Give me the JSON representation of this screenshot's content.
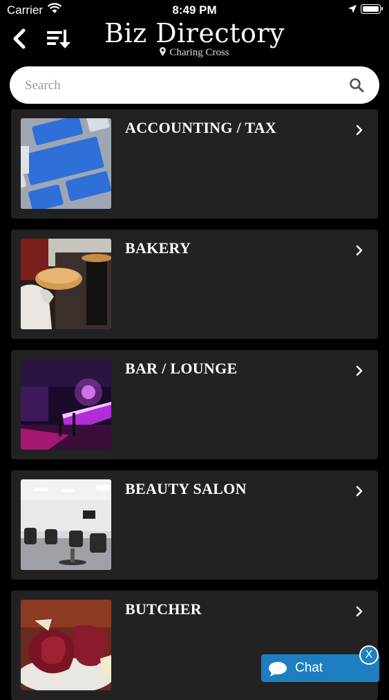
{
  "status_bar": {
    "carrier": "Carrier",
    "time": "8:49 PM"
  },
  "header": {
    "title": "Biz Directory",
    "location": "Charing Cross",
    "back_icon": "chevron-left-icon",
    "sort_icon": "sort-list-icon"
  },
  "search": {
    "placeholder": "Search",
    "value": ""
  },
  "categories": [
    {
      "label": "ACCOUNTING / TAX"
    },
    {
      "label": "BAKERY"
    },
    {
      "label": "BAR / LOUNGE"
    },
    {
      "label": "BEAUTY SALON"
    },
    {
      "label": "BUTCHER"
    }
  ],
  "chat_widget": {
    "label": "Chat",
    "close_label": "X",
    "accent": "#1d7fc1"
  },
  "colors": {
    "background": "#000000",
    "card": "#222223",
    "text": "#ffffff"
  }
}
